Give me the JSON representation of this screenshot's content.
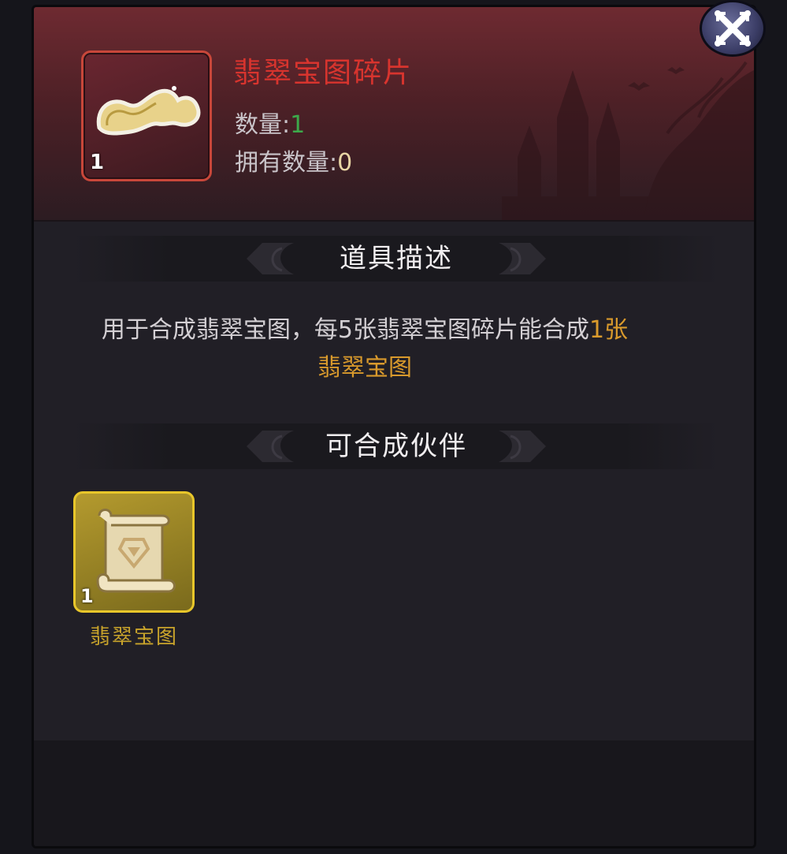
{
  "item": {
    "name": "翡翠宝图碎片",
    "count_badge": "1",
    "quantity_label": "数量:",
    "quantity_value": "1",
    "owned_label": "拥有数量:",
    "owned_value": "0"
  },
  "sections": {
    "description_title": "道具描述",
    "craftable_title": "可合成伙伴"
  },
  "description": {
    "text": "用于合成翡翠宝图，每5张翡翠宝图碎片能合成",
    "highlight_1": "1张",
    "highlight_2": "翡翠宝图"
  },
  "craftable": [
    {
      "name": "翡翠宝图",
      "count": "1",
      "icon": "scroll-icon"
    }
  ],
  "colors": {
    "title_red": "#d8342e",
    "highlight_gold": "#d99a2c",
    "quantity_green": "#3caa4a"
  }
}
